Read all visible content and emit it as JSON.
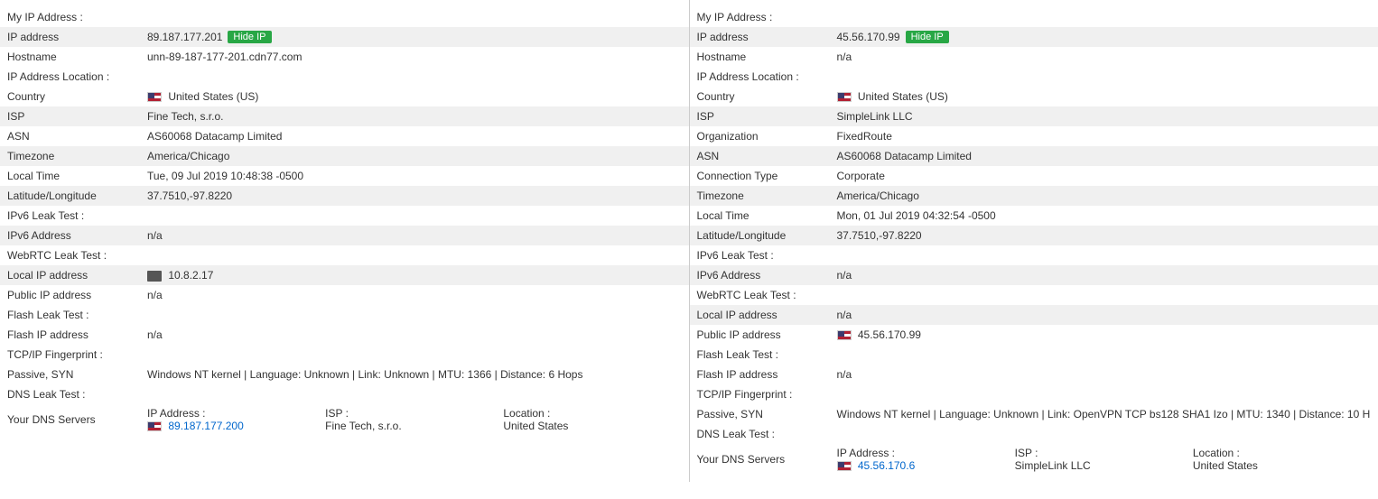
{
  "left": {
    "my_ip_header": "My IP Address :",
    "ip_address_label": "IP address",
    "ip_address_value": "89.187.177.201",
    "hide_ip_button": "Hide IP",
    "hostname_label": "Hostname",
    "hostname_value": "unn-89-187-177-201.cdn77.com",
    "ip_location_header": "IP Address Location :",
    "country_label": "Country",
    "country_value": "United States (US)",
    "isp_label": "ISP",
    "isp_value": "Fine Tech, s.r.o.",
    "asn_label": "ASN",
    "asn_value": "AS60068 Datacamp Limited",
    "timezone_label": "Timezone",
    "timezone_value": "America/Chicago",
    "local_time_label": "Local Time",
    "local_time_value": "Tue, 09 Jul 2019 10:48:38 -0500",
    "lat_lon_label": "Latitude/Longitude",
    "lat_lon_value": "37.7510,-97.8220",
    "ipv6_header": "IPv6 Leak Test :",
    "ipv6_address_label": "IPv6 Address",
    "ipv6_address_value": "n/a",
    "webrtc_header": "WebRTC Leak Test :",
    "local_ip_label": "Local IP address",
    "local_ip_value": "10.8.2.17",
    "public_ip_label": "Public IP address",
    "public_ip_value": "n/a",
    "flash_header": "Flash Leak Test :",
    "flash_ip_label": "Flash IP address",
    "flash_ip_value": "n/a",
    "tcpip_header": "TCP/IP Fingerprint :",
    "passive_syn_label": "Passive, SYN",
    "passive_syn_value": "Windows NT kernel | Language: Unknown | Link: Unknown | MTU: 1366 | Distance: 6 Hops",
    "dns_header": "DNS Leak Test :",
    "your_dns_label": "Your DNS Servers",
    "dns_ip_col": "IP Address :",
    "dns_isp_col": "ISP :",
    "dns_location_col": "Location :",
    "dns_ip_value": "89.187.177.200",
    "dns_isp_value": "Fine Tech, s.r.o.",
    "dns_location_value": "United States"
  },
  "right": {
    "my_ip_header": "My IP Address :",
    "ip_address_label": "IP address",
    "ip_address_value": "45.56.170.99",
    "hide_ip_button": "Hide IP",
    "hostname_label": "Hostname",
    "hostname_value": "n/a",
    "ip_location_header": "IP Address Location :",
    "country_label": "Country",
    "country_value": "United States (US)",
    "isp_label": "ISP",
    "isp_value": "SimpleLink LLC",
    "organization_label": "Organization",
    "organization_value": "FixedRoute",
    "asn_label": "ASN",
    "asn_value": "AS60068 Datacamp Limited",
    "connection_type_label": "Connection Type",
    "connection_type_value": "Corporate",
    "timezone_label": "Timezone",
    "timezone_value": "America/Chicago",
    "local_time_label": "Local Time",
    "local_time_value": "Mon, 01 Jul 2019 04:32:54 -0500",
    "lat_lon_label": "Latitude/Longitude",
    "lat_lon_value": "37.7510,-97.8220",
    "ipv6_header": "IPv6 Leak Test :",
    "ipv6_address_label": "IPv6 Address",
    "ipv6_address_value": "n/a",
    "webrtc_header": "WebRTC Leak Test :",
    "local_ip_label": "Local IP address",
    "local_ip_value": "n/a",
    "public_ip_label": "Public IP address",
    "public_ip_value": "45.56.170.99",
    "flash_header": "Flash Leak Test :",
    "flash_ip_label": "Flash IP address",
    "flash_ip_value": "n/a",
    "tcpip_header": "TCP/IP Fingerprint :",
    "passive_syn_label": "Passive, SYN",
    "passive_syn_value": "Windows NT kernel | Language: Unknown | Link: OpenVPN TCP bs128 SHA1 Izo | MTU: 1340 | Distance: 10 H",
    "dns_header": "DNS Leak Test :",
    "your_dns_label": "Your DNS Servers",
    "dns_ip_col": "IP Address :",
    "dns_isp_col": "ISP :",
    "dns_location_col": "Location :",
    "dns_ip_value": "45.56.170.6",
    "dns_isp_value": "SimpleLink LLC",
    "dns_location_value": "United States"
  }
}
